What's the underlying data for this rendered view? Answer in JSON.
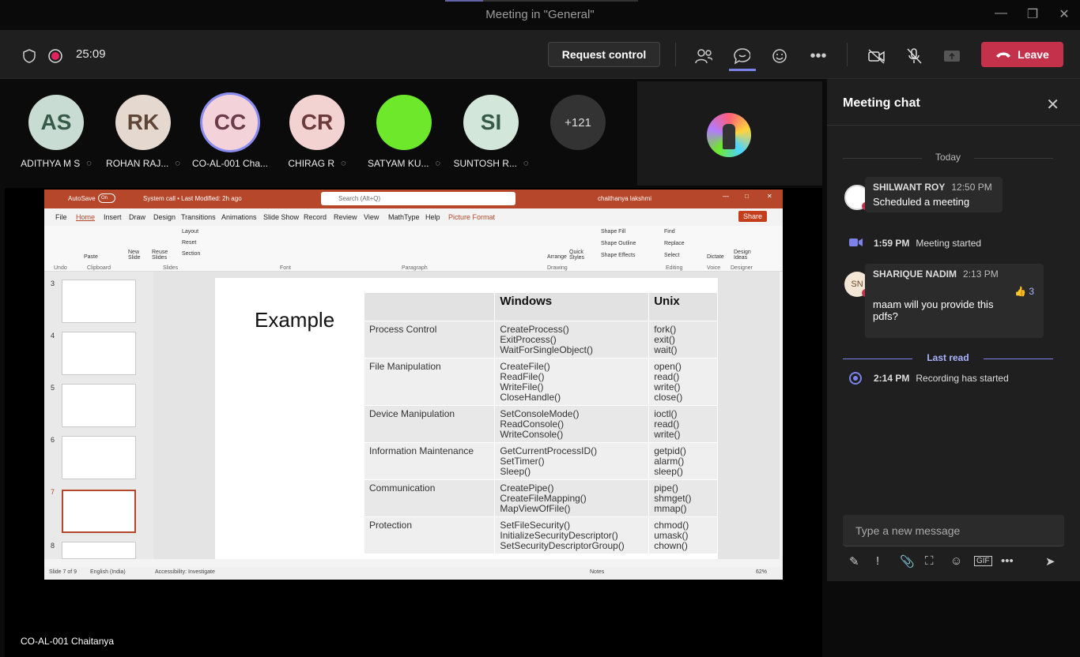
{
  "window": {
    "title": "Meeting in \"General\""
  },
  "toolbar": {
    "timer": "25:09",
    "request_control": "Request control",
    "leave": "Leave"
  },
  "participants": [
    {
      "initials": "AS",
      "name": "ADITHYA M S",
      "color": "#c9dcd3"
    },
    {
      "initials": "RK",
      "name": "ROHAN RAJ...",
      "color": "#e5d8cf"
    },
    {
      "initials": "CC",
      "name": "CO-AL-001 Cha...",
      "color": "#f3d2da"
    },
    {
      "initials": "CR",
      "name": "CHIRAG R",
      "color": "#f3d2d2"
    },
    {
      "initials": "",
      "name": "SATYAM KU...",
      "color": "#6ee82a"
    },
    {
      "initials": "SI",
      "name": "SUNTOSH R...",
      "color": "#d3e6da"
    }
  ],
  "more_count": "+121",
  "presenter": {
    "name": "CO-AL-001 Chaitanya"
  },
  "ppt": {
    "autosave": "AutoSave",
    "toggle": "On",
    "filename": "System call • Last Modified: 2h ago",
    "search": "Search (Alt+Q)",
    "user": "chaithanya lakshmi",
    "share": "Share",
    "menu": [
      "File",
      "Home",
      "Insert",
      "Draw",
      "Design",
      "Transitions",
      "Animations",
      "Slide Show",
      "Record",
      "Review",
      "View",
      "MathType",
      "Help",
      "Picture Format"
    ],
    "ribbon_groups": [
      "Undo",
      "Clipboard",
      "Slides",
      "Font",
      "Paragraph",
      "Drawing",
      "Editing",
      "Voice",
      "Designer"
    ],
    "ribbon_labels": {
      "paste": "Paste",
      "new_slide": "New Slide",
      "reuse": "Reuse Slides",
      "layout": "Layout",
      "reset": "Reset",
      "section": "Section",
      "arrange": "Arrange",
      "quick_styles": "Quick Styles",
      "shape_fill": "Shape Fill",
      "shape_outline": "Shape Outline",
      "shape_effects": "Shape Effects",
      "find": "Find",
      "replace": "Replace",
      "select": "Select",
      "dictate": "Dictate",
      "design_ideas": "Design Ideas"
    },
    "thumb_numbers": [
      "3",
      "4",
      "5",
      "6",
      "7",
      "8"
    ],
    "status": {
      "slide": "Slide 7 of 9",
      "lang": "English (India)",
      "access": "Accessibility: Investigate",
      "notes": "Notes",
      "zoom": "62%"
    }
  },
  "slide": {
    "title": "Example",
    "headers": [
      "",
      "Windows",
      "Unix"
    ],
    "rows": [
      {
        "cat": "Process Control",
        "win": "CreateProcess()\nExitProcess()\nWaitForSingleObject()",
        "unix": "fork()\nexit()\nwait()"
      },
      {
        "cat": "File Manipulation",
        "win": "CreateFile()\nReadFile()\nWriteFile()\nCloseHandle()",
        "unix": "open()\nread()\nwrite()\nclose()"
      },
      {
        "cat": "Device Manipulation",
        "win": "SetConsoleMode()\nReadConsole()\nWriteConsole()",
        "unix": "ioctl()\nread()\nwrite()"
      },
      {
        "cat": "Information Maintenance",
        "win": "GetCurrentProcessID()\nSetTimer()\nSleep()",
        "unix": "getpid()\nalarm()\nsleep()"
      },
      {
        "cat": "Communication",
        "win": "CreatePipe()\nCreateFileMapping()\nMapViewOfFile()",
        "unix": "pipe()\nshmget()\nmmap()"
      },
      {
        "cat": "Protection",
        "win": "SetFileSecurity()\nInitializeSecurityDescriptor()\nSetSecurityDescriptorGroup()",
        "unix": "chmod()\numask()\nchown()"
      }
    ]
  },
  "chat": {
    "title": "Meeting chat",
    "today": "Today",
    "messages": [
      {
        "sender": "SHILWANT ROY",
        "time": "12:50 PM",
        "text": "Scheduled a meeting"
      },
      {
        "sender": "SHARIQUE NADIM",
        "time": "2:13 PM",
        "text": "maam will you provide this pdfs?",
        "reaction_count": "3",
        "initials": "SN"
      }
    ],
    "events": [
      {
        "time": "1:59 PM",
        "text": "Meeting started"
      },
      {
        "time": "2:14 PM",
        "text": "Recording has started"
      }
    ],
    "last_read": "Last read",
    "input_placeholder": "Type a new message"
  }
}
